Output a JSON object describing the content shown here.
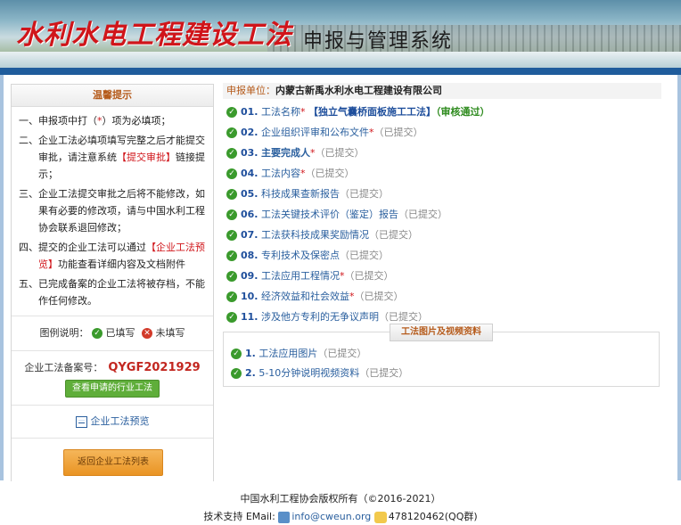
{
  "banner": {
    "calligraphy": "水利水电工程建设工法",
    "system_title": "申报与管理系统"
  },
  "tips": {
    "title": "温馨提示",
    "line1_pre": "一、申报项中打（",
    "line1_star": "*",
    "line1_post": "）项为必填项；",
    "line2_pre": "二、企业工法必填项填写完整之后才能提交审批，请注意系统",
    "line2_link": "【提交审批】",
    "line2_post": "链接提示；",
    "line3": "三、企业工法提交审批之后将不能修改，如果有必要的修改项，请与中国水利工程协会联系退回修改；",
    "line4_pre": "四、提交的企业工法可以通过",
    "line4_link": "【企业工法预览】",
    "line4_post": "功能查看详细内容及文档附件",
    "line5": "五、已完成备案的企业工法将被存档，不能作任何修改。"
  },
  "legend": {
    "label": "图例说明：",
    "filled": "已填写",
    "unfilled": "未填写"
  },
  "record": {
    "label": "企业工法备案号：",
    "number": "QYGF2021929",
    "view_button": "查看申请的行业工法"
  },
  "preview_link": "企业工法预览",
  "back_button": "返回企业工法列表",
  "applicant": {
    "label": "申报单位：",
    "name": "内蒙古新禹水利水电工程建设有限公司"
  },
  "items": [
    {
      "no": "01.",
      "name": "工法名称",
      "star": "*",
      "extra": "【独立气囊桥面板施工工法】",
      "status": "（审核通过）"
    },
    {
      "no": "02.",
      "name": "企业组织评审和公布文件",
      "star": "*",
      "status": "（已提交）"
    },
    {
      "no": "03.",
      "name": "主要完成人",
      "star": "*",
      "status": "（已提交）"
    },
    {
      "no": "04.",
      "name": "工法内容",
      "star": "*",
      "status": "（已提交）"
    },
    {
      "no": "05.",
      "name": "科技成果查新报告",
      "star": "",
      "status": "（已提交）"
    },
    {
      "no": "06.",
      "name": "工法关键技术评价（鉴定）报告",
      "star": "",
      "status": "（已提交）"
    },
    {
      "no": "07.",
      "name": "工法获科技成果奖励情况",
      "star": "",
      "status": "（已提交）"
    },
    {
      "no": "08.",
      "name": "专利技术及保密点",
      "star": "",
      "status": "（已提交）"
    },
    {
      "no": "09.",
      "name": "工法应用工程情况",
      "star": "*",
      "status": "（已提交）"
    },
    {
      "no": "10.",
      "name": "经济效益和社会效益",
      "star": "*",
      "status": "（已提交）"
    },
    {
      "no": "11.",
      "name": "涉及他方专利的无争议声明",
      "star": "",
      "status": "（已提交）"
    }
  ],
  "media": {
    "title": "工法图片及视频资料",
    "items": [
      {
        "no": "1.",
        "name": "工法应用图片",
        "status": "（已提交）"
      },
      {
        "no": "2.",
        "name": "5-10分钟说明视频资料",
        "status": "（已提交）"
      }
    ]
  },
  "footer": {
    "copyright": "中国水利工程协会版权所有（©2016-2021）",
    "support_label": "技术支持 EMail:",
    "email": "info@cweun.org",
    "qq": "478120462(QQ群)"
  },
  "colors": {
    "accent_red": "#d0151a",
    "link_blue": "#2a5f9e",
    "ok_green": "#3a9a2c",
    "bar_blue": "#1f5c9c"
  }
}
